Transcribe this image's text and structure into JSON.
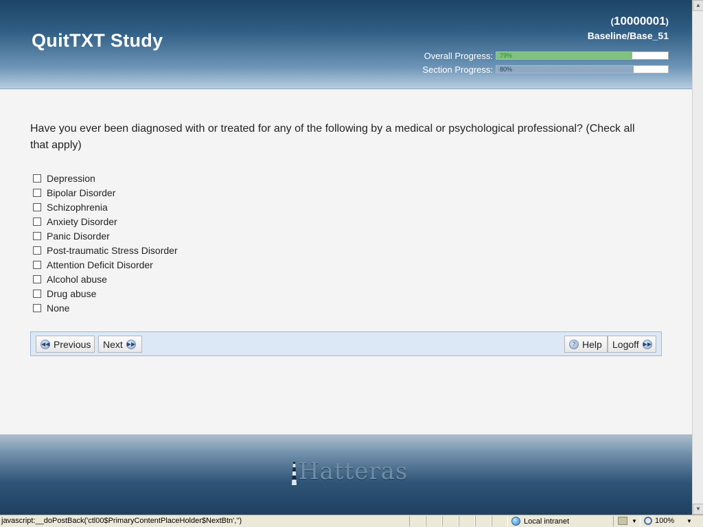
{
  "header": {
    "app_title": "QuitTXT Study",
    "participant_id": "10000001",
    "paren_open": "(",
    "paren_close": ")",
    "survey_page": "Baseline/Base_51",
    "overall_progress_label": "Overall Progress:",
    "overall_progress_value": 79,
    "overall_progress_text": "79%",
    "section_progress_label": "Section Progress:",
    "section_progress_value": 80,
    "section_progress_text": "80%"
  },
  "question": {
    "text": "Have you ever been diagnosed with or treated for any of the following by a medical or psychological professional? (Check all that apply)",
    "options": [
      {
        "label": "Depression",
        "checked": false
      },
      {
        "label": "Bipolar Disorder",
        "checked": false
      },
      {
        "label": "Schizophrenia",
        "checked": false
      },
      {
        "label": "Anxiety Disorder",
        "checked": false
      },
      {
        "label": "Panic Disorder",
        "checked": false
      },
      {
        "label": "Post-traumatic Stress Disorder",
        "checked": false
      },
      {
        "label": "Attention Deficit Disorder",
        "checked": false
      },
      {
        "label": "Alcohol abuse",
        "checked": false
      },
      {
        "label": "Drug abuse",
        "checked": false
      },
      {
        "label": "None",
        "checked": false
      }
    ]
  },
  "nav": {
    "previous_label": "Previous",
    "next_label": "Next",
    "help_label": "Help",
    "logoff_label": "Logoff"
  },
  "footer": {
    "logo_text": "Hatteras"
  },
  "statusbar": {
    "status_text": "javascript:__doPostBack('ctl00$PrimaryContentPlaceHolder$NextBtn','')",
    "zone_label": "Local intranet",
    "zoom_label": "100%"
  },
  "colors": {
    "header_dark": "#1d4466",
    "nav_bar_bg": "#dce8f6",
    "overall_progress": "#7ec27e",
    "section_progress": "#8fa9c2"
  }
}
